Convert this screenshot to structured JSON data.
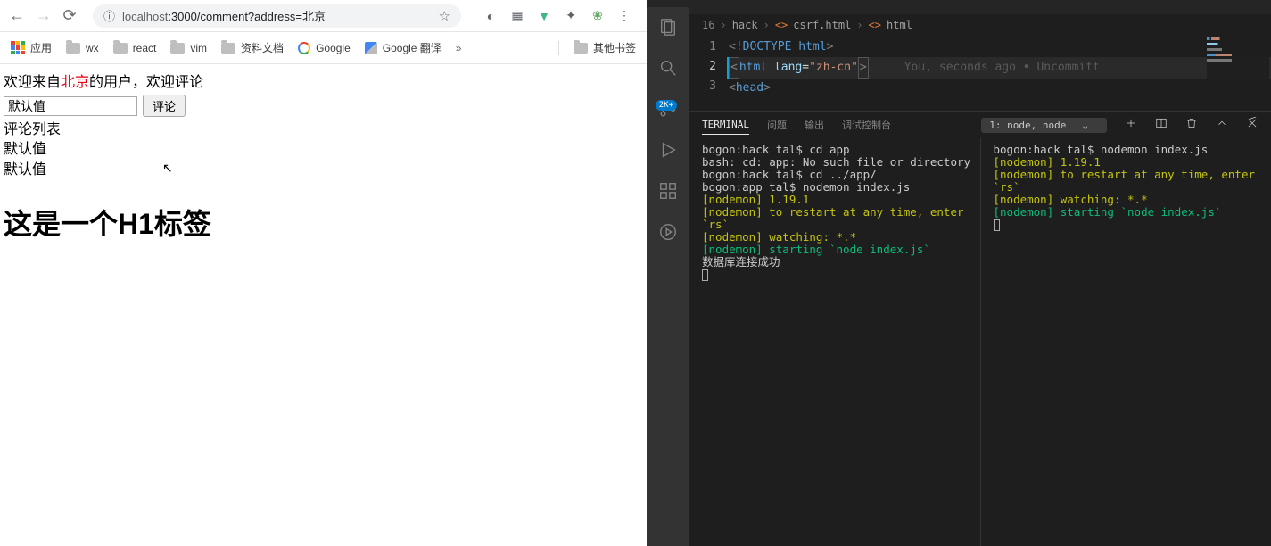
{
  "browser": {
    "url_domain": "localhost",
    "url_rest": ":3000/comment?address=北京",
    "bookmarks": {
      "apps": "应用",
      "items": [
        {
          "label": "wx"
        },
        {
          "label": "react"
        },
        {
          "label": "vim"
        },
        {
          "label": "资料文档"
        }
      ],
      "google": "Google",
      "translate": "Google 翻译",
      "more": "»",
      "other": "其他书签"
    },
    "page": {
      "welcome_pre": "欢迎来自",
      "welcome_city": "北京",
      "welcome_post": "的用户，欢迎评论",
      "input_value": "默认值",
      "submit_label": "评论",
      "list_title": "评论列表",
      "list_items": [
        "默认值",
        "默认值"
      ],
      "heading": "这是一个H1标签"
    }
  },
  "vscode": {
    "breadcrumb": {
      "num": "16",
      "folder": "hack",
      "file": "csrf.html",
      "node": "html"
    },
    "code": {
      "lines": [
        "1",
        "2",
        "3"
      ],
      "l1_doctype": "DOCTYPE",
      "l1_html": "html",
      "l2_tag": "html",
      "l2_attr": "lang",
      "l2_val": "\"zh-cn\"",
      "l2_annot": "You, seconds ago • Uncommitt",
      "l3_tag": "head"
    },
    "panel": {
      "tabs": {
        "terminal": "TERMINAL",
        "problems": "问题",
        "output": "输出",
        "debug": "调试控制台"
      },
      "select_value": "1: node, node",
      "term1": [
        {
          "cls": "t-white",
          "text": "bogon:hack tal$ cd app"
        },
        {
          "cls": "t-white",
          "text": "bash: cd: app: No such file or directory"
        },
        {
          "cls": "t-white",
          "text": "bogon:hack tal$ cd ../app/"
        },
        {
          "cls": "t-white",
          "text": "bogon:app tal$ nodemon index.js"
        },
        {
          "cls": "t-yellow",
          "text": "[nodemon] 1.19.1"
        },
        {
          "cls": "t-yellow",
          "text": "[nodemon] to restart at any time, enter `rs`"
        },
        {
          "cls": "t-yellow",
          "text": "[nodemon] watching: *.*"
        },
        {
          "cls": "t-green",
          "text": "[nodemon] starting `node index.js`"
        },
        {
          "cls": "t-white",
          "text": "数据库连接成功"
        }
      ],
      "term2": [
        {
          "cls": "t-white",
          "text": "bogon:hack tal$ nodemon index.js"
        },
        {
          "cls": "t-yellow",
          "text": "[nodemon] 1.19.1"
        },
        {
          "cls": "t-yellow",
          "text": "[nodemon] to restart at any time, enter `rs`"
        },
        {
          "cls": "t-yellow",
          "text": "[nodemon] watching: *.*"
        },
        {
          "cls": "t-green",
          "text": "[nodemon] starting `node index.js`"
        }
      ]
    },
    "activity_badge": "2K+"
  }
}
